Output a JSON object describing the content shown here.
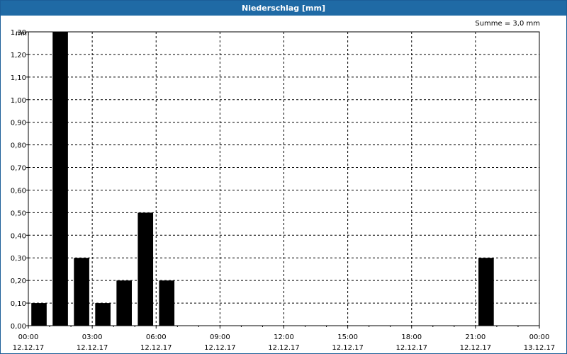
{
  "window": {
    "title": "Niederschlag [mm]"
  },
  "chart_data": {
    "type": "bar",
    "title": "Niederschlag [mm]",
    "unit_label": "mm",
    "summary": "Summe = 3,0 mm",
    "y_ticks": [
      "0,00",
      "0,10",
      "0,20",
      "0,30",
      "0,40",
      "0,50",
      "0,60",
      "0,70",
      "0,80",
      "0,90",
      "1,00",
      "1,10",
      "1,20",
      "1,30"
    ],
    "ylim": [
      0,
      1.3
    ],
    "x_ticks": [
      {
        "time": "00:00",
        "date": "12.12.17"
      },
      {
        "time": "03:00",
        "date": "12.12.17"
      },
      {
        "time": "06:00",
        "date": "12.12.17"
      },
      {
        "time": "09:00",
        "date": "12.12.17"
      },
      {
        "time": "12:00",
        "date": "12.12.17"
      },
      {
        "time": "15:00",
        "date": "12.12.17"
      },
      {
        "time": "18:00",
        "date": "12.12.17"
      },
      {
        "time": "21:00",
        "date": "12.12.17"
      },
      {
        "time": "00:00",
        "date": "13.12.17"
      }
    ],
    "bar_color": "#000000",
    "grid": true,
    "bars": [
      {
        "hour": 0,
        "value": 0.1
      },
      {
        "hour": 1,
        "value": 1.3
      },
      {
        "hour": 2,
        "value": 0.3
      },
      {
        "hour": 3,
        "value": 0.1
      },
      {
        "hour": 4,
        "value": 0.2
      },
      {
        "hour": 5,
        "value": 0.5
      },
      {
        "hour": 6,
        "value": 0.2
      },
      {
        "hour": 21,
        "value": 0.3
      }
    ]
  }
}
